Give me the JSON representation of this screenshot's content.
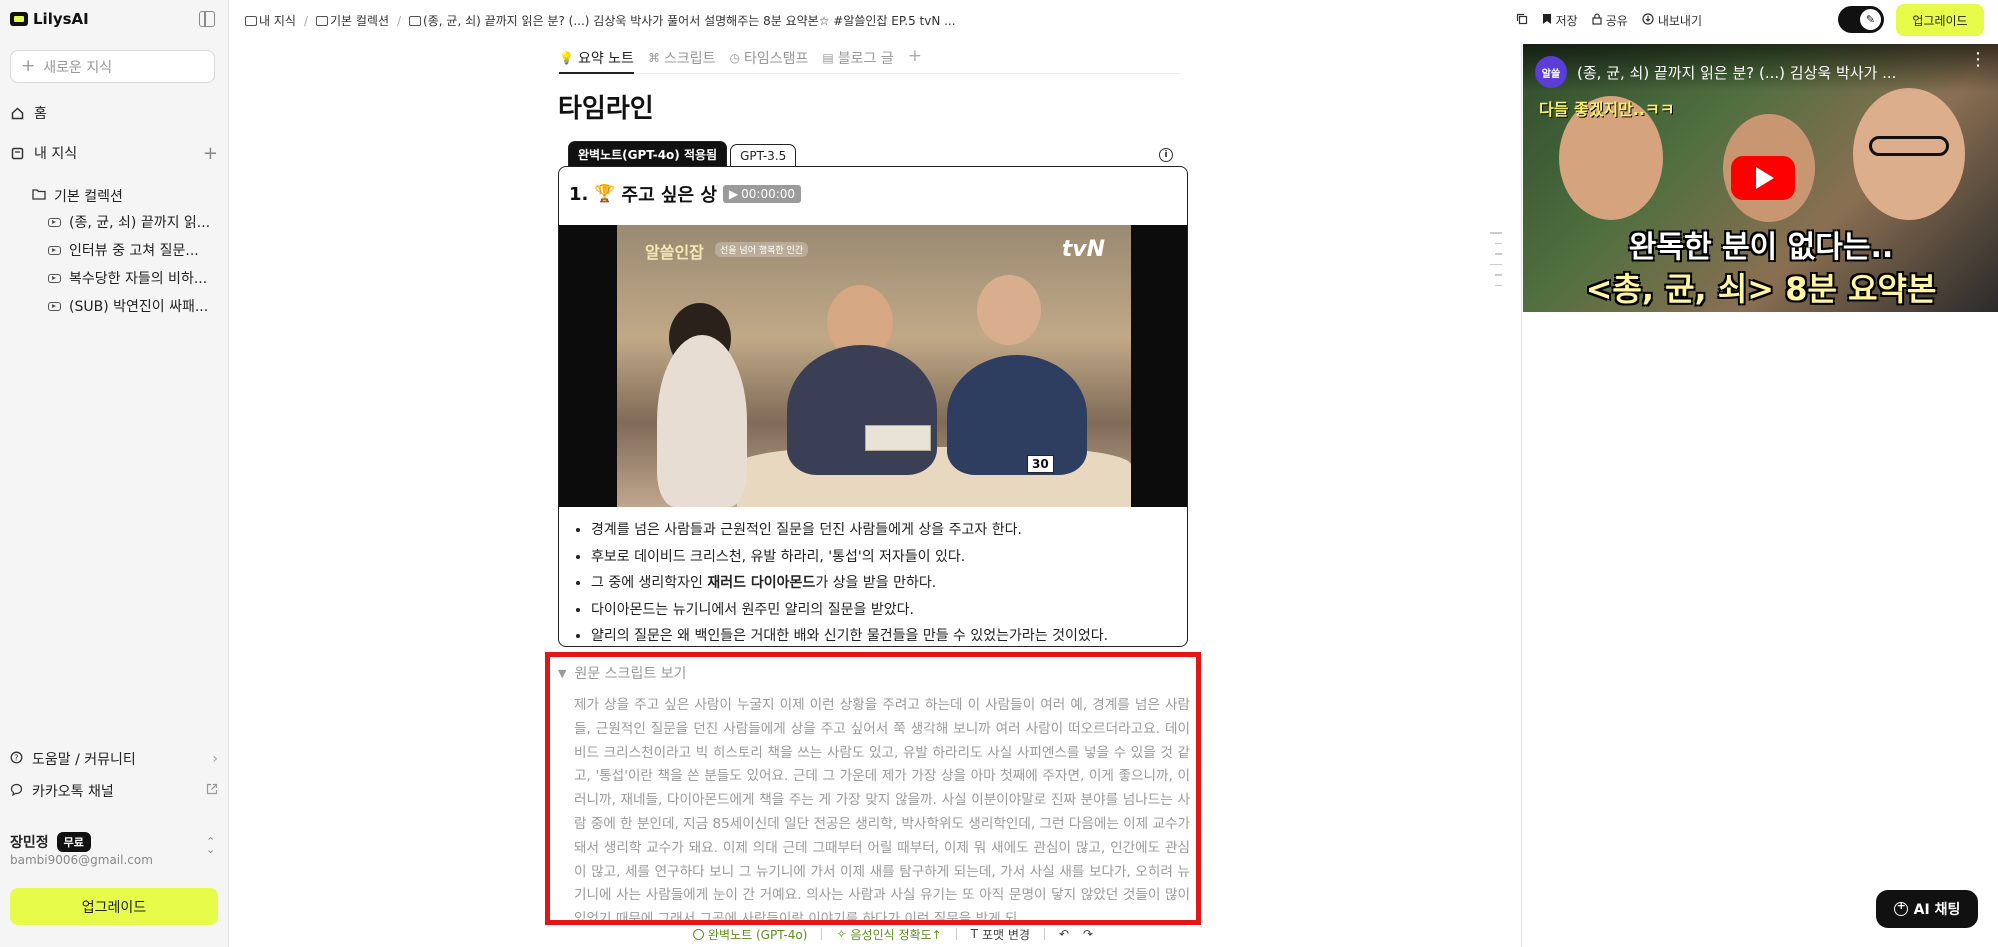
{
  "sidebar": {
    "logo": "LilysAI",
    "new_knowledge_placeholder": "새로운 지식",
    "home": "홈",
    "my_knowledge": "내 지식",
    "folder": "기본 컬렉션",
    "items": [
      {
        "label": "(종, 균, 쇠) 끝까지 읽..."
      },
      {
        "label": "인터뷰 중 고쳐 질문..."
      },
      {
        "label": "복수당한 자들의 비하..."
      },
      {
        "label": "(SUB) 박연진이 싸패..."
      }
    ],
    "help": "도움말 / 커뮤니티",
    "kakao": "카카오톡 채널",
    "user_name": "장민정",
    "user_plan": "무료",
    "user_email": "bambi9006@gmail.com",
    "upgrade": "업그레이드"
  },
  "topbar": {
    "breadcrumb": {
      "root": "내 지식",
      "folder": "기본 컬렉션",
      "current": "(종, 균, 쇠) 끝까지 읽은 분? (...) 김상욱 박사가 풀어서 설명해주는 8분 요약본☆ #알쓸인잡 EP.5 tvN ..."
    },
    "actions": {
      "save": "저장",
      "share": "공유",
      "export": "내보내기"
    },
    "upgrade": "업그레이드"
  },
  "note": {
    "tabs": [
      {
        "label": "요약 노트",
        "icon": "bulb-icon"
      },
      {
        "label": "스크립트",
        "icon": "script-icon"
      },
      {
        "label": "타임스탬프",
        "icon": "clock-icon"
      },
      {
        "label": "블로그 글",
        "icon": "doc-icon"
      }
    ],
    "title": "타임라인",
    "model_active": "완벽노트(GPT-4o) 적용됨",
    "model_alt": "GPT-3.5",
    "section_number": "1.",
    "section_title": "주고 싶은 상",
    "section_emoji": "🏆",
    "timestamp": "00:00:00",
    "video_logo": "알쓸인잡",
    "video_tag": "선을 넘어 행복한 인간",
    "video_channel": "tvN",
    "video_sign": "30",
    "bullets": [
      {
        "pre": "경계를 넘은 사람들과 근원적인 질문을 던진 사람들에게 상을 주고자 한다.",
        "bold": "",
        "post": ""
      },
      {
        "pre": "후보로 데이비드 크리스천, 유발 하라리, '통섭'의 저자들이 있다.",
        "bold": "",
        "post": ""
      },
      {
        "pre": "그 중에 생리학자인 ",
        "bold": "재러드 다이아몬드",
        "post": "가 상을 받을 만하다."
      },
      {
        "pre": "다이아몬드는 뉴기니에서 원주민 얄리의 질문을 받았다.",
        "bold": "",
        "post": ""
      },
      {
        "pre": "얄리의 질문은 왜 백인들은 거대한 배와 신기한 물건들을 만들 수 있었는가라는 것이었다.",
        "bold": "",
        "post": ""
      }
    ],
    "script_toggle": "원문 스크립트 보기",
    "script_text": "제가 상을 주고 싶은 사람이 누굴지 이제 이런 상황을 주려고 하는데 이 사람들이 여러 예, 경계를 넘은 사람들, 근원적인 질문을 던진 사람들에게 상을 주고 싶어서 쭉 생각해 보니까 여러 사람이 떠오르더라고요. 데이비드 크리스천이라고 빅 히스토리 책을 쓰는 사람도 있고, 유발 하라리도 사실 사피엔스를 넣을 수 있을 것 같고, '통섭'이란 책을 쓴 분들도 있어요. 근데 그 가운데 제가 가장 상을 아마 첫째에 주자면, 이게 좋으니까, 이러니까, 재네들, 다이아몬드에게 책을 주는 게 가장 맞지 않을까. 사실 이분이야말로 진짜 분야를 넘나드는 사람 중에 한 분인데, 지금 85세이신데 일단 전공은 생리학, 박사학위도 생리학인데, 그런 다음에는 이제 교수가 돼서 생리학 교수가 돼요. 이제 의대 근데 그때부터 어릴 때부터, 이제 뭐 새에도 관심이 많고, 인간에도 관심이 많고, 세를 연구하다 보니 그 뉴기니에 가서 이제 새를 탐구하게 되는데, 가서 사실 새를 보다가, 오히려 뉴기니에 사는 사람들에게 눈이 간 거예요. 의사는 사람과 사실 유기는 또 아직 문명이 닿지 않았던 것들이 많이 있었기 때문에 그래서 그곳에 사람들이랑 이야기를 하다가 이런 질문을 받게 되"
  },
  "bottom_bar": {
    "perfect_note": "완벽노트 (GPT-4o)",
    "voice_accuracy": "음성인식 정확도↑",
    "format_change": "포맷 변경"
  },
  "player": {
    "channel_avatar": "알쓸",
    "title": "(종, 균, 쇠) 끝까지 읽은 분? (...) 김상욱 박사가 ...",
    "caption_top": "다들 좋겠지만..ㅋㅋ",
    "caption_1": "완독한 분이 없다는..",
    "caption_2": "<총, 균, 쇠> 8분 요약본"
  },
  "ai_chat": "AI 채팅",
  "colors": {
    "accent": "#e6fb4a",
    "highlight_border": "#e11616",
    "badge_bg": "#111111"
  }
}
